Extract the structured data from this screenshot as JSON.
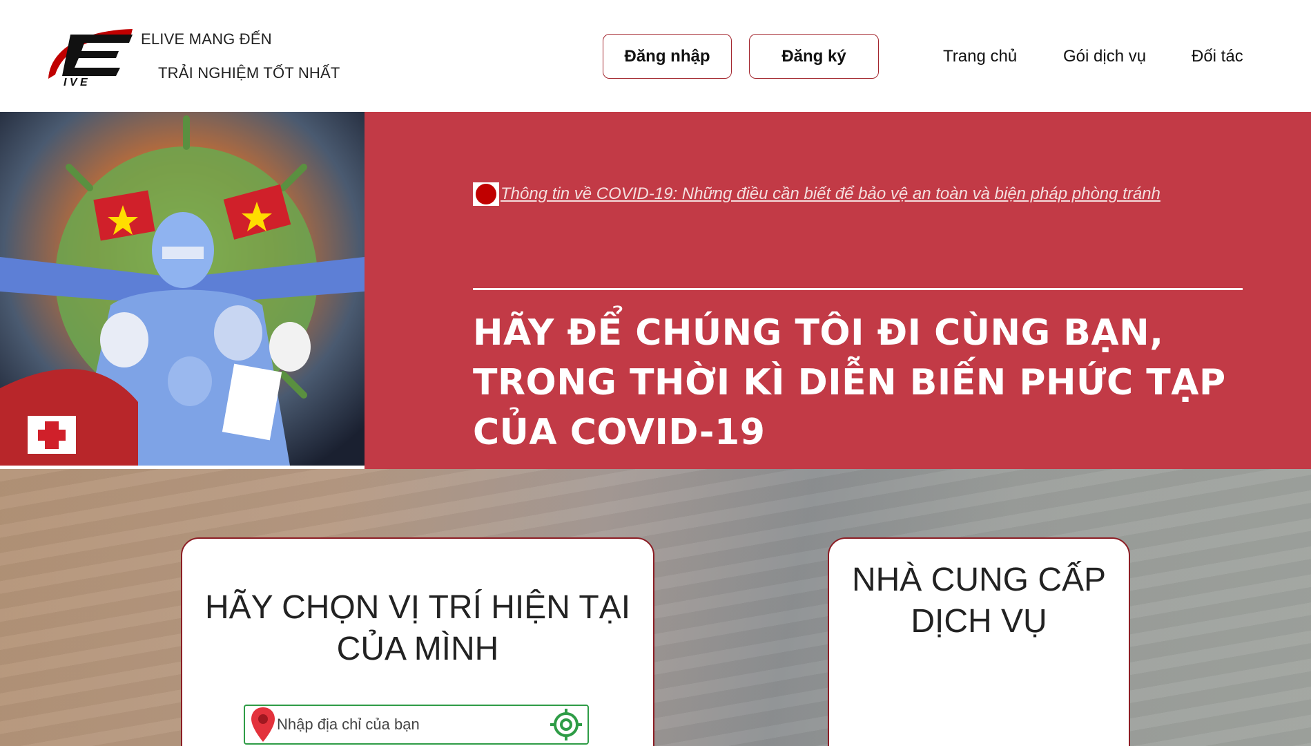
{
  "header": {
    "tagline_line1": "ELIVE MANG ĐẾN",
    "tagline_line2": "TRẢI NGHIỆM TỐT NHẤT",
    "login_label": "Đăng nhập",
    "register_label": "Đăng ký",
    "nav": {
      "home": "Trang chủ",
      "services": "Gói dịch vụ",
      "partners": "Đối tác"
    }
  },
  "hero": {
    "news_link": "Thông tin về COVID-19: Những điều cần biết để bảo vệ an toàn và biện pháp phòng tránh",
    "title_line1": "HÃY ĐỂ CHÚNG TÔI ĐI CÙNG BẠN,",
    "title_line2": "TRONG THỜI KÌ DIỄN BIẾN PHỨC TẠP",
    "title_line3": "CỦA COVID-19"
  },
  "location_card": {
    "title_line1": "HÃY CHỌN VỊ TRÍ HIỆN TẠI",
    "title_line2": "CỦA MÌNH",
    "address_placeholder": "Nhập địa chỉ của bạn"
  },
  "provider_card": {
    "title_line1": "NHÀ CUNG CẤP",
    "title_line2": "DỊCH VỤ"
  },
  "colors": {
    "brand_red": "#c23a46",
    "border_red": "#a3262e",
    "input_green": "#2e9c46"
  },
  "icons": [
    "elive-logo",
    "red-dot-icon",
    "map-pin-icon",
    "locate-target-icon"
  ]
}
